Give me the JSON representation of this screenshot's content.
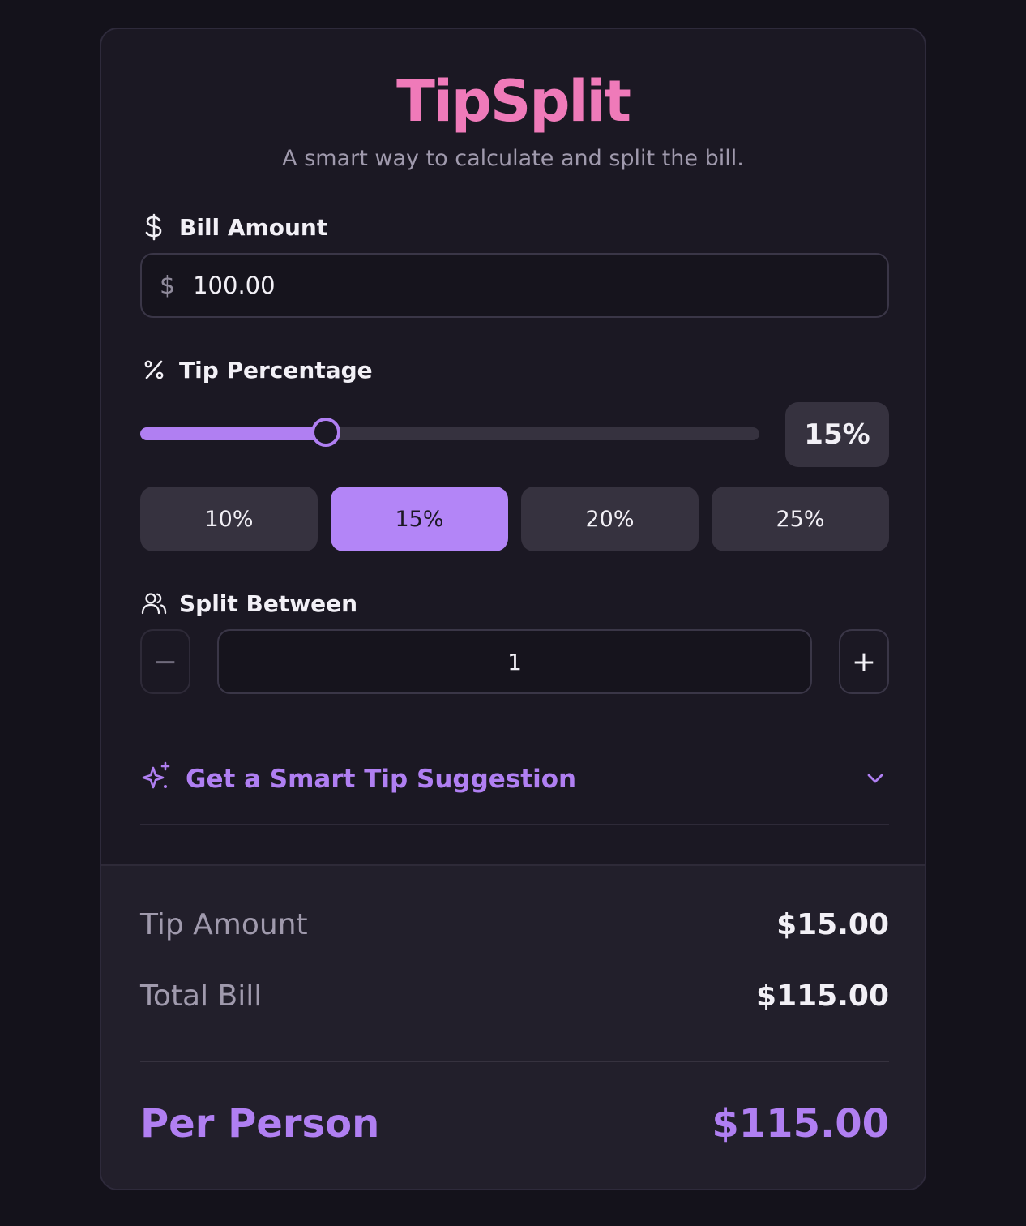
{
  "app": {
    "title": "TipSplit",
    "subtitle": "A smart way to calculate and split the bill."
  },
  "bill": {
    "label": "Bill Amount",
    "icon": "dollar-icon",
    "currency_symbol": "$",
    "value": "100.00"
  },
  "tip": {
    "label": "Tip Percentage",
    "icon": "percent-icon",
    "slider_percent": 15,
    "slider_max_percent": 50,
    "display": "15%",
    "presets": [
      {
        "label": "10%",
        "active": false
      },
      {
        "label": "15%",
        "active": true
      },
      {
        "label": "20%",
        "active": false
      },
      {
        "label": "25%",
        "active": false
      }
    ]
  },
  "split": {
    "label": "Split Between",
    "icon": "users-icon",
    "value": "1",
    "minus_label": "−",
    "plus_label": "+"
  },
  "suggestion": {
    "label": "Get a Smart Tip Suggestion",
    "icon": "sparkles-icon",
    "chevron": "chevron-down-icon"
  },
  "results": {
    "tip_amount_label": "Tip Amount",
    "tip_amount_value": "$15.00",
    "total_label": "Total Bill",
    "total_value": "$115.00",
    "per_person_label": "Per Person",
    "per_person_value": "$115.00"
  },
  "colors": {
    "accent": "#b07ff2",
    "brand_pink": "#ef7ab9",
    "background": "#14121b",
    "card": "#1b1823"
  }
}
